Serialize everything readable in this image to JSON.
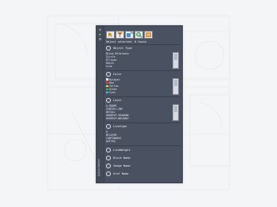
{
  "panel": {
    "vertical_title": "Quick Select",
    "handle_buttons": [
      "close-icon",
      "pin-icon",
      "menu-icon"
    ],
    "toolbar_icons": [
      "select-all-icon",
      "filter-icon",
      "add-to-set-icon",
      "zoom-icon",
      "settings-icon"
    ],
    "selected_count": "Object selected: 0 found"
  },
  "sections": [
    {
      "title": "Object Type",
      "items": [
        "Block Reference",
        "Circle",
        "Ellipse",
        "Hatch",
        "Line"
      ]
    },
    {
      "title": "Color",
      "items": [
        {
          "label": "ByLayer",
          "color": "#e8ecf0"
        },
        {
          "label": "Red",
          "color": "#e03a3a"
        },
        {
          "label": "Yellow",
          "color": "#e8d84a"
        },
        {
          "label": "Green",
          "color": "#3ab04a"
        },
        {
          "label": "Cyan",
          "color": "#3ac8d8"
        }
      ]
    },
    {
      "title": "Layer",
      "items": [
        "A-DOORS",
        "CENTER-LINE",
        "DETAIL",
        "HARDSCP-SHADOWS",
        "HARDSCP-WALKWAY"
      ]
    },
    {
      "title": "Linetype",
      "items": [
        "0",
        "BYLAYER",
        "CONTINUOUS",
        "DOTTED"
      ]
    }
  ],
  "bottom_sections": [
    "LineWeight",
    "Block Name",
    "Image Name",
    "Xref Name"
  ]
}
